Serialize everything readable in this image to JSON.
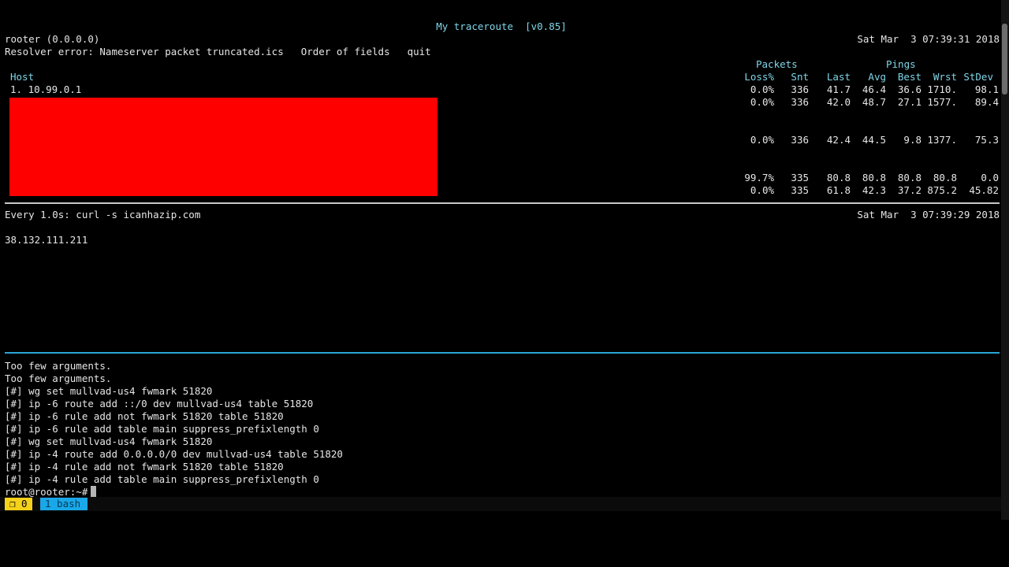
{
  "mtr": {
    "title": "My traceroute  [v0.85]",
    "host": "rooter (0.0.0.0)",
    "date": "Sat Mar  3 07:39:31 2018",
    "resolver_error": "Resolver error: Nameserver packet truncated.",
    "keys": {
      "k1": "ics",
      "k2": "Order of fields",
      "k3": "quit"
    },
    "headers": {
      "packets": "Packets",
      "pings": "Pings",
      "host": "Host",
      "loss": "Loss%",
      "snt": "Snt",
      "last": "Last",
      "avg": "Avg",
      "best": "Best",
      "wrst": "Wrst",
      "stdev": "StDev"
    },
    "rows": [
      {
        "host": "1. 10.99.0.1",
        "loss": "0.0%",
        "snt": "336",
        "last": "41.7",
        "avg": "46.4",
        "best": "36.6",
        "wrst": "1710.",
        "stdev": "98.1"
      },
      {
        "host": "",
        "loss": "0.0%",
        "snt": "336",
        "last": "42.0",
        "avg": "48.7",
        "best": "27.1",
        "wrst": "1577.",
        "stdev": "89.4"
      },
      {
        "host": "",
        "loss": "0.0%",
        "snt": "336",
        "last": "42.4",
        "avg": "44.5",
        "best": "9.8",
        "wrst": "1377.",
        "stdev": "75.3"
      },
      {
        "host": "",
        "loss": "99.7%",
        "snt": "335",
        "last": "80.8",
        "avg": "80.8",
        "best": "80.8",
        "wrst": "80.8",
        "stdev": "0.0"
      },
      {
        "host": "",
        "loss": "0.0%",
        "snt": "335",
        "last": "61.8",
        "avg": "42.3",
        "best": "37.2",
        "wrst": "875.2",
        "stdev": "45.82"
      }
    ]
  },
  "watch": {
    "command": "Every 1.0s: curl -s icanhazip.com",
    "date": "Sat Mar  3 07:39:29 2018",
    "output": "38.132.111.211"
  },
  "shell": {
    "lines": [
      "Too few arguments.",
      "Too few arguments.",
      "[#] wg set mullvad-us4 fwmark 51820",
      "[#] ip -6 route add ::/0 dev mullvad-us4 table 51820",
      "[#] ip -6 rule add not fwmark 51820 table 51820",
      "[#] ip -6 rule add table main suppress_prefixlength 0",
      "[#] wg set mullvad-us4 fwmark 51820",
      "[#] ip -4 route add 0.0.0.0/0 dev mullvad-us4 table 51820",
      "[#] ip -4 rule add not fwmark 51820 table 51820",
      "[#] ip -4 rule add table main suppress_prefixlength 0"
    ],
    "prompt": "root@rooter:~#"
  },
  "tmux": {
    "session_label": "❐ 0",
    "window_label": "1 bash",
    "session_color": "#f4d11a",
    "window_color": "#1aa7e8"
  },
  "colors": {
    "redaction": "#ff0000",
    "header": "#7fd6e8",
    "separator_bottom": "#2aa6d6"
  }
}
